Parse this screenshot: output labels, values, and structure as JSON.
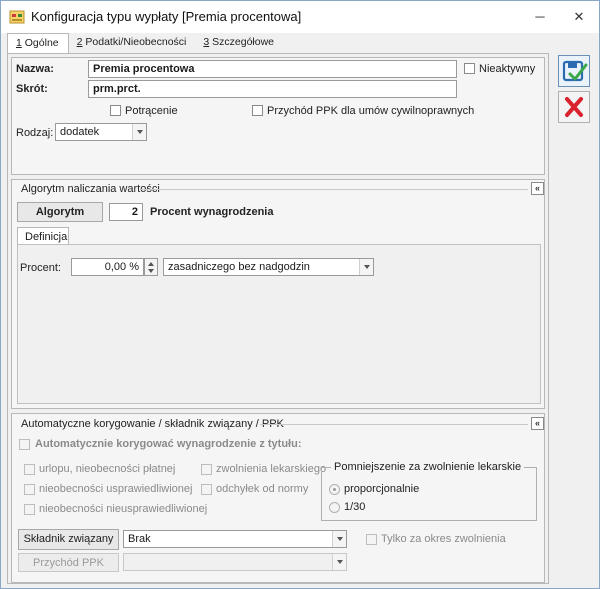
{
  "window": {
    "title": "Konfiguracja typu wypłaty [Premia procentowa]",
    "minimize": "─",
    "close": "✕"
  },
  "tabs": [
    {
      "key": "1",
      "label": " Ogólne",
      "active": true
    },
    {
      "key": "2",
      "label": " Podatki/Nieobecności",
      "active": false
    },
    {
      "key": "3",
      "label": " Szczegółowe",
      "active": false
    }
  ],
  "general": {
    "name_label": "Nazwa:",
    "name_value": "Premia procentowa",
    "inactive_label": "Nieaktywny",
    "short_label": "Skrót:",
    "short_value": "prm.prct.",
    "deduction_label": "Potrącenie",
    "ppk_label": "Przychód PPK dla umów cywilnoprawnych",
    "type_label": "Rodzaj:",
    "type_value": "dodatek"
  },
  "algorithm": {
    "section_title": "Algorytm naliczania wartości",
    "button_label": "Algorytm",
    "number": "2",
    "description": "Procent wynagrodzenia",
    "subtab": "Definicja",
    "percent_label": "Procent:",
    "percent_value": "0,00 %",
    "basis_value": "zasadniczego bez nadgodzin"
  },
  "auto": {
    "section_title": "Automatyczne korygowanie / składnik związany / PPK",
    "auto_correct_label": "Automatycznie korygować wynagrodzenie z tytułu:",
    "options_left": [
      "urlopu, nieobecności płatnej",
      "nieobecności usprawiedliwionej",
      "nieobecności nieusprawiedliwionej"
    ],
    "options_mid": [
      "zwolnienia lekarskiego",
      "odchyłek od normy"
    ],
    "reduction_title": "Pomniejszenie za zwolnienie lekarskie",
    "reduction_options": [
      "proporcjonalnie",
      "1/30"
    ],
    "linked_button": "Składnik związany",
    "linked_value": "Brak",
    "only_sick_label": "Tylko za okres zwolnienia",
    "ppk_button": "Przychód PPK",
    "ppk_value": ""
  },
  "colors": {
    "save_accent": "#2b6cb0",
    "cancel_accent": "#d9232d"
  }
}
